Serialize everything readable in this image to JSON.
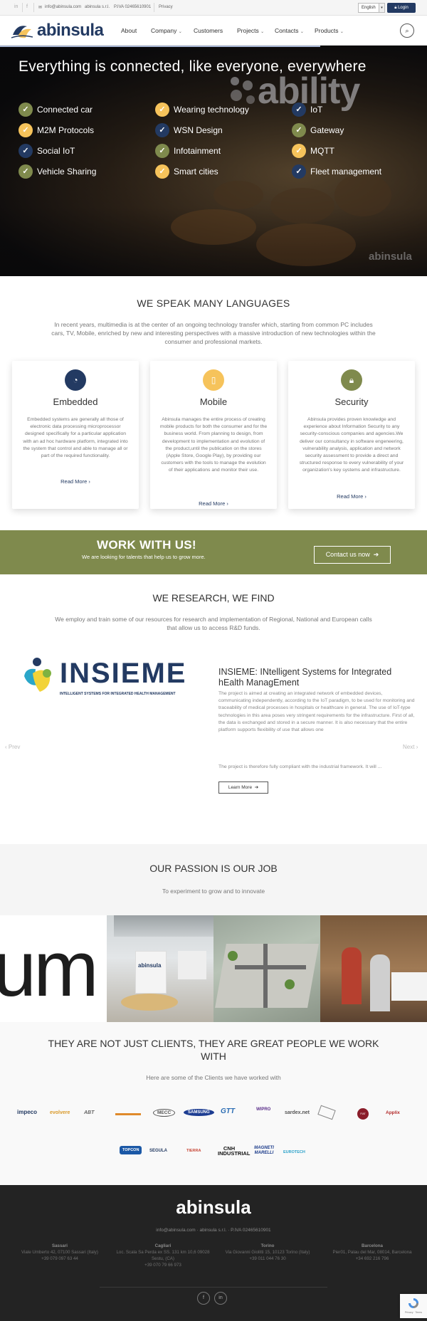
{
  "topbar": {
    "email": "info@abinsula.com",
    "company": "abinsula s.r.l.",
    "vat": "P.IVA 02465610901",
    "privacy": "Privacy",
    "language": "English",
    "login": "Login"
  },
  "nav": {
    "logo": "abinsula",
    "items": [
      "About",
      "Company",
      "Customers",
      "Projects",
      "Contacts",
      "Products"
    ]
  },
  "hero": {
    "title": "Everything is connected, like everyone, everywhere",
    "features": [
      "Connected car",
      "Wearing technology",
      "IoT",
      "M2M Protocols",
      "WSN Design",
      "Gateway",
      "Social IoT",
      "Infotainment",
      "MQTT",
      "Vehicle Sharing",
      "Smart cities",
      "Fleet management"
    ],
    "overlay": "ability",
    "watermark": "abinsula"
  },
  "languages": {
    "title": "WE SPEAK MANY LANGUAGES",
    "intro": "In recent years, multimedia is at the center of an ongoing technology transfer which, starting from common PC includes cars, TV, Mobile, enriched by new and interesting perspectives with a massive introduction of new technologies within the consumer and professional markets.",
    "cards": [
      {
        "title": "Embedded",
        "body": "Embedded systems are generally all those of electronic data processing microprocessor designed specifically for a particular application with an ad hoc hardware platform, integrated into the system that control and able to manage all or part of the required functionality.",
        "link": "Read More"
      },
      {
        "title": "Mobile",
        "body": "Abinsula manages the entire process of creating mobile products for both the consumer and for the business world. From planning to design, from development to implementation and evolution of the product,until the publication on the stores (Apple Store, Google Play), by providing our customers with the tools to manage the evolution of their applications and monitor their use.",
        "link": "Read More"
      },
      {
        "title": "Security",
        "body": "Abinsula provides proven knowledge and experience about Information Security to any security-conscious companies and agencies.We deliver our consultancy in software engeneering, vulnerability analysis, application and network security assessment to provide a direct and structured response to every vulnerability of your organization's key systems and infrastructure.",
        "link": "Read More"
      }
    ]
  },
  "work": {
    "title": "WORK WITH US!",
    "subtitle": "We are looking for talents that help us to grow more.",
    "button": "Contact us now"
  },
  "research": {
    "title": "WE RESEARCH, WE FIND",
    "intro": "We employ and train some of our resources for research and implementation of Regional, National and European calls that allow us to access R&D funds.",
    "logo_word": "INSIEME",
    "logo_tag": "INTELLIGENT SYSTEMS FOR INTEGRATED HEALTH MANAGEMENT",
    "project_title": "INSIEME: INtelligent Systems for Integrated hEalth ManagEment",
    "project_body": "The project is aimed at creating an integrated network of embedded devices, communicating independently, according to the IoT paradigm, to be used for monitoring and traceability of medical processes in hospitals or healthcare in general. The use of IoT-type technologies in this area poses very stringent requirements for the infrastructure. First of all, the data is exchanged and stored in a secure manner. It is also necessary that the entire platform supports flexibility of use that allows one",
    "project_more": "The project is therefore fully compliant with the industrial framework. It will ...",
    "button": "Learn More",
    "prev": "Prev",
    "next": "Next"
  },
  "passion": {
    "title": "OUR PASSION IS OUR JOB",
    "subtitle": "To experiment to grow and to innovate",
    "photo_text": "um"
  },
  "clients": {
    "title": "THEY ARE NOT JUST CLIENTS, THEY ARE GREAT PEOPLE WE WORK WITH",
    "subtitle": "Here are some of the Clients we have worked with",
    "logos": [
      "impeco",
      "evolvere",
      "ABT",
      "—",
      "MECC",
      "SAMSUNG",
      "GTT",
      "WIPRO",
      "sardex.net",
      "—",
      "FIAT",
      "Applix",
      "TOPCON",
      "SEGULA",
      "TIERRA",
      "CNH INDUSTRIAL",
      "MAGNETI MARELLI",
      "EUROTECH"
    ]
  },
  "footer": {
    "logo": "abinsula",
    "contact": "info@abinsula.com · abinsula s.r.l. · P.IVA 02465610901",
    "offices": [
      {
        "city": "Sassari",
        "address": "Viale Umberto 42, 07100 Sassari (Italy)",
        "phone": "+39 079 097 63 44"
      },
      {
        "city": "Cagliari",
        "address": "Loc. Scala Sa Perda ex SS. 131 km 10,6 09028 Sestu, (CA)",
        "phone": "+39 070 79 66 973"
      },
      {
        "city": "Torino",
        "address": "Via Giovanni Giolitti 15, 10123 Torino (Italy)",
        "phone": "+39 011 044 76 30"
      },
      {
        "city": "Barcelona",
        "address": "Pier01, Palau del Mar, 08014, Barcelona",
        "phone": "+34 692 216 796"
      }
    ]
  },
  "colors": {
    "navy": "#233a62",
    "olive": "#7f8a4d",
    "gold": "#f6c35b",
    "footer": "#232323"
  }
}
